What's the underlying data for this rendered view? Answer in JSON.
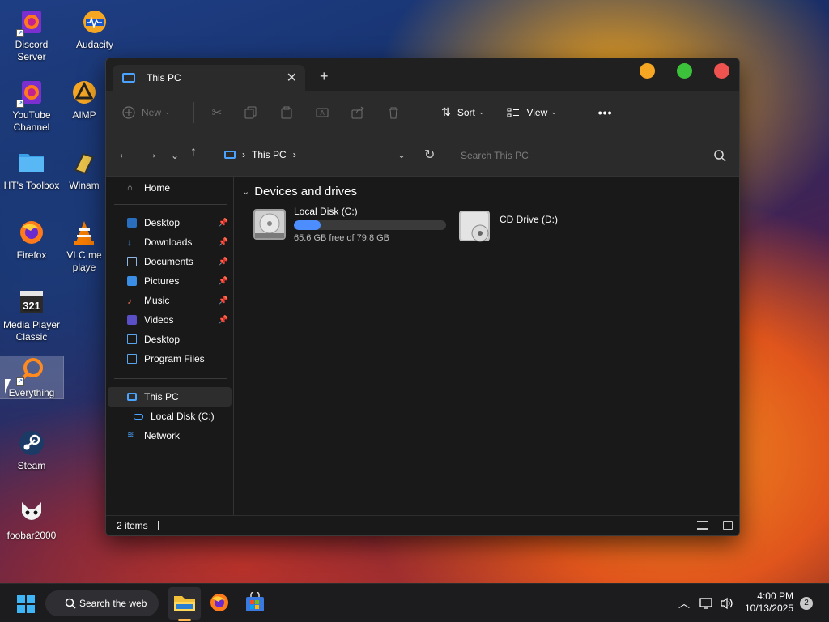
{
  "desktop": {
    "icons": [
      {
        "label": "Discord\nServer",
        "icon": "firefox-shortcut-icon"
      },
      {
        "label": "YouTube\nChannel",
        "icon": "firefox-shortcut-icon"
      },
      {
        "label": "HT's Toolbox",
        "icon": "folder-icon"
      },
      {
        "label": "Firefox",
        "icon": "firefox-icon"
      },
      {
        "label": "Media Player\nClassic",
        "icon": "media-player-classic-icon"
      },
      {
        "label": "Everything",
        "icon": "everything-search-icon"
      },
      {
        "label": "Steam",
        "icon": "steam-icon"
      },
      {
        "label": "foobar2000",
        "icon": "foobar2000-icon"
      },
      {
        "label": "Audacity",
        "icon": "audacity-icon"
      },
      {
        "label": "AIMP",
        "icon": "aimp-icon"
      },
      {
        "label": "Winam",
        "icon": "winamp-icon"
      },
      {
        "label": "VLC me\nplaye",
        "icon": "vlc-icon"
      }
    ]
  },
  "window": {
    "tab_title": "This PC",
    "new_tab": "+",
    "close_tab": "✕",
    "controls": {
      "minimize_color": "#f5a623",
      "maximize_color": "#3cc13b",
      "close_color": "#ef5350"
    },
    "toolbar": {
      "new_label": "New",
      "sort_label": "Sort",
      "view_label": "View",
      "more_label": "•••"
    },
    "address": {
      "breadcrumb": "This PC",
      "search_placeholder": "Search This PC"
    },
    "nav": {
      "home": "Home",
      "quick_access": [
        {
          "label": "Desktop",
          "pinned": true,
          "icon": "desktop-icon"
        },
        {
          "label": "Downloads",
          "pinned": true,
          "icon": "downloads-icon"
        },
        {
          "label": "Documents",
          "pinned": true,
          "icon": "documents-icon"
        },
        {
          "label": "Pictures",
          "pinned": true,
          "icon": "pictures-icon"
        },
        {
          "label": "Music",
          "pinned": true,
          "icon": "music-icon"
        },
        {
          "label": "Videos",
          "pinned": true,
          "icon": "videos-icon"
        },
        {
          "label": "Desktop",
          "pinned": false,
          "icon": "folder-icon"
        },
        {
          "label": "Program Files",
          "pinned": false,
          "icon": "folder-icon"
        }
      ],
      "this_pc": "This PC",
      "local_disk": "Local Disk (C:)",
      "network": "Network"
    },
    "content": {
      "group_header": "Devices and drives",
      "drives": [
        {
          "name": "Local Disk (C:)",
          "free_text": "65.6 GB free of 79.8 GB",
          "used_fraction": 0.178,
          "icon": "hard-drive-icon"
        },
        {
          "name": "CD Drive (D:)",
          "icon": "cd-drive-icon"
        }
      ]
    },
    "status": {
      "items": "2 items"
    }
  },
  "taskbar": {
    "search_label": "Search the web",
    "time": "4:00 PM",
    "date": "10/13/2025",
    "notification_count": "2"
  }
}
